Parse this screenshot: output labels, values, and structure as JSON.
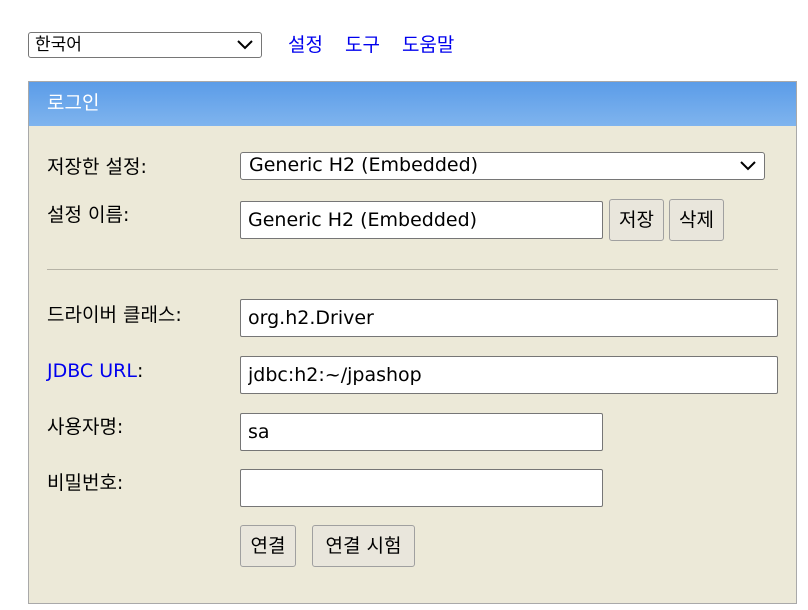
{
  "top": {
    "language": "한국어",
    "links": [
      "설정",
      "도구",
      "도움말"
    ]
  },
  "login": {
    "title": "로그인",
    "saved_settings_label": "저장한 설정:",
    "saved_settings_value": "Generic H2 (Embedded)",
    "setting_name_label": "설정 이름:",
    "setting_name_value": "Generic H2 (Embedded)",
    "save_button": "저장",
    "delete_button": "삭제",
    "driver_class_label": "드라이버 클래스:",
    "driver_class_value": "org.h2.Driver",
    "jdbc_url_label": "JDBC URL",
    "jdbc_url_colon": ":",
    "jdbc_url_value": "jdbc:h2:~/jpashop",
    "username_label": "사용자명:",
    "username_value": "sa",
    "password_label": "비밀번호:",
    "password_value": "",
    "connect_button": "연결",
    "test_connect_button": "연결 시험"
  },
  "colors": {
    "header_blue": "#6ea8ec",
    "panel_bg": "#ece9d8",
    "link_blue": "#0000ee"
  }
}
